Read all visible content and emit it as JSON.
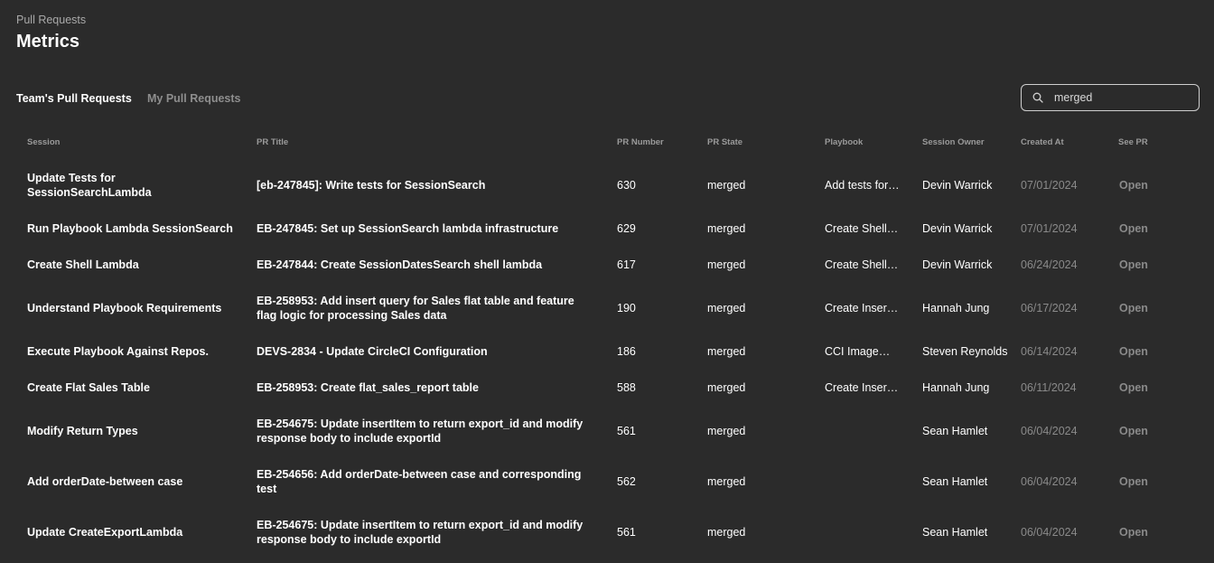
{
  "header": {
    "breadcrumb": "Pull Requests",
    "title": "Metrics"
  },
  "tabs": [
    {
      "label": "Team's Pull Requests",
      "active": true
    },
    {
      "label": "My Pull Requests",
      "active": false
    }
  ],
  "search": {
    "value": "merged",
    "icon": "search-icon"
  },
  "table": {
    "columns": [
      "Session",
      "PR Title",
      "PR Number",
      "PR State",
      "Playbook",
      "Session Owner",
      "Created At",
      "See PR"
    ],
    "rows": [
      {
        "session": "Update Tests for SessionSearchLambda",
        "pr_title": "[eb-247845]: Write tests for SessionSearch",
        "pr_number": "630",
        "pr_state": "merged",
        "playbook": "Add tests for…",
        "owner": "Devin Warrick",
        "created_at": "07/01/2024",
        "see_pr": "Open"
      },
      {
        "session": "Run Playbook Lambda SessionSearch",
        "pr_title": "EB-247845: Set up SessionSearch lambda infrastructure",
        "pr_number": "629",
        "pr_state": "merged",
        "playbook": "Create Shell…",
        "owner": "Devin Warrick",
        "created_at": "07/01/2024",
        "see_pr": "Open"
      },
      {
        "session": "Create Shell Lambda",
        "pr_title": "EB-247844: Create SessionDatesSearch shell lambda",
        "pr_number": "617",
        "pr_state": "merged",
        "playbook": "Create Shell…",
        "owner": "Devin Warrick",
        "created_at": "06/24/2024",
        "see_pr": "Open"
      },
      {
        "session": "Understand Playbook Requirements",
        "pr_title": "EB-258953: Add insert query for Sales flat table and feature flag logic for processing Sales data",
        "pr_number": "190",
        "pr_state": "merged",
        "playbook": "Create Insert…",
        "owner": "Hannah Jung",
        "created_at": "06/17/2024",
        "see_pr": "Open"
      },
      {
        "session": "Execute Playbook Against Repos.",
        "pr_title": "DEVS-2834 - Update CircleCI Configuration",
        "pr_number": "186",
        "pr_state": "merged",
        "playbook": "CCI Image…",
        "owner": "Steven Reynolds",
        "created_at": "06/14/2024",
        "see_pr": "Open"
      },
      {
        "session": "Create Flat Sales Table",
        "pr_title": "EB-258953: Create flat_sales_report table",
        "pr_number": "588",
        "pr_state": "merged",
        "playbook": "Create Insert…",
        "owner": "Hannah Jung",
        "created_at": "06/11/2024",
        "see_pr": "Open"
      },
      {
        "session": "Modify Return Types",
        "pr_title": "EB-254675: Update insertItem to return export_id and modify response body to include exportId",
        "pr_number": "561",
        "pr_state": "merged",
        "playbook": "",
        "owner": "Sean Hamlet",
        "created_at": "06/04/2024",
        "see_pr": "Open"
      },
      {
        "session": "Add orderDate-between case",
        "pr_title": "EB-254656: Add orderDate-between case and corresponding test",
        "pr_number": "562",
        "pr_state": "merged",
        "playbook": "",
        "owner": "Sean Hamlet",
        "created_at": "06/04/2024",
        "see_pr": "Open"
      },
      {
        "session": "Update CreateExportLambda",
        "pr_title": "EB-254675: Update insertItem to return export_id and modify response body to include exportId",
        "pr_number": "561",
        "pr_state": "merged",
        "playbook": "",
        "owner": "Sean Hamlet",
        "created_at": "06/04/2024",
        "see_pr": "Open"
      }
    ]
  }
}
